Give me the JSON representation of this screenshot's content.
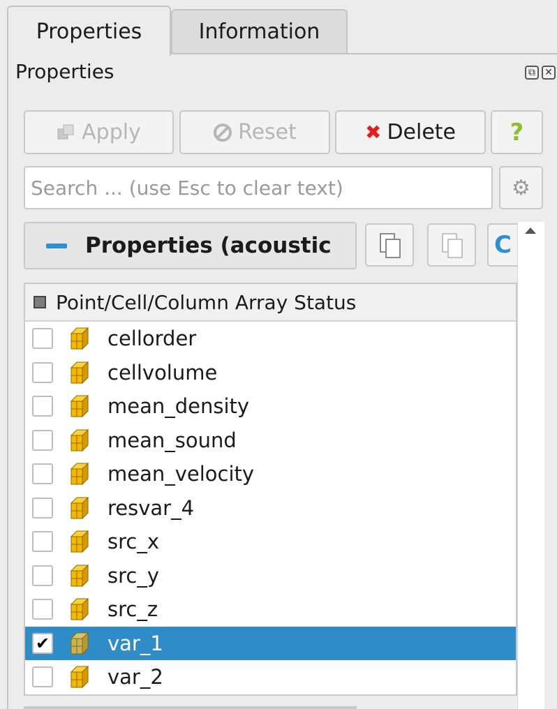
{
  "tabs": [
    {
      "label": "Properties",
      "active": true
    },
    {
      "label": "Information",
      "active": false
    }
  ],
  "dock": {
    "title": "Properties"
  },
  "toolbar": {
    "apply_label": "Apply",
    "reset_label": "Reset",
    "delete_label": "Delete",
    "help_label": "?"
  },
  "search": {
    "placeholder": "Search ... (use Esc to clear text)"
  },
  "section": {
    "title": "Properties (acoustic"
  },
  "table": {
    "header": "Point/Cell/Column Array Status",
    "rows": [
      {
        "name": "cellorder",
        "checked": false
      },
      {
        "name": "cellvolume",
        "checked": false
      },
      {
        "name": "mean_density",
        "checked": false
      },
      {
        "name": "mean_sound",
        "checked": false
      },
      {
        "name": "mean_velocity",
        "checked": false
      },
      {
        "name": "resvar_4",
        "checked": false
      },
      {
        "name": "src_x",
        "checked": false
      },
      {
        "name": "src_y",
        "checked": false
      },
      {
        "name": "src_z",
        "checked": false
      },
      {
        "name": "var_1",
        "checked": true,
        "selected": true
      },
      {
        "name": "var_2",
        "checked": false
      }
    ]
  },
  "colors": {
    "accent": "#2f8fd1",
    "selection": "#308cc6",
    "cube": "#f5b800",
    "help": "#8fbf2e",
    "delete": "#e02020"
  }
}
